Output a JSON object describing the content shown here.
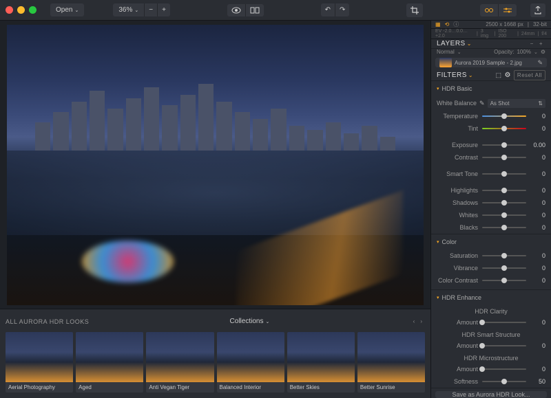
{
  "toolbar": {
    "open": "Open",
    "zoom": "36%"
  },
  "info": {
    "dims": "2500 x 1668 px",
    "depth": "32-bit",
    "ev": "EV -2.0…0.0…+2.0",
    "imgs": "3 img",
    "iso": "ISO 200",
    "focal": "24mm",
    "aperture": "f/4"
  },
  "layers": {
    "title": "LAYERS",
    "blend": "Normal",
    "opacity_label": "Opacity:",
    "opacity_val": "100%",
    "layer_name": "Aurora 2019 Sample - 2.jpg"
  },
  "filters": {
    "title": "FILTERS",
    "reset": "Reset All"
  },
  "hdr_basic": {
    "title": "HDR Basic",
    "wb_label": "White Balance",
    "wb_preset": "As Shot",
    "sliders": [
      {
        "label": "Temperature",
        "val": "0",
        "grad": "grad-temp"
      },
      {
        "label": "Tint",
        "val": "0",
        "grad": "grad-tint"
      },
      {
        "label": "Exposure",
        "val": "0.00"
      },
      {
        "label": "Contrast",
        "val": "0"
      },
      {
        "label": "Smart Tone",
        "val": "0"
      },
      {
        "label": "Highlights",
        "val": "0"
      },
      {
        "label": "Shadows",
        "val": "0"
      },
      {
        "label": "Whites",
        "val": "0"
      },
      {
        "label": "Blacks",
        "val": "0"
      }
    ]
  },
  "color": {
    "title": "Color",
    "sliders": [
      {
        "label": "Saturation",
        "val": "0"
      },
      {
        "label": "Vibrance",
        "val": "0"
      },
      {
        "label": "Color Contrast",
        "val": "0"
      }
    ]
  },
  "enhance": {
    "title": "HDR Enhance",
    "clarity": "HDR Clarity",
    "clarity_sliders": [
      {
        "label": "Amount",
        "val": "0",
        "pos": "0%"
      }
    ],
    "smart": "HDR Smart Structure",
    "smart_sliders": [
      {
        "label": "Amount",
        "val": "0",
        "pos": "0%"
      }
    ],
    "micro": "HDR Microstructure",
    "micro_sliders": [
      {
        "label": "Amount",
        "val": "0",
        "pos": "0%"
      },
      {
        "label": "Softness",
        "val": "50",
        "pos": "50%"
      }
    ]
  },
  "looks": {
    "title": "ALL AURORA HDR LOOKS",
    "collections": "Collections",
    "items": [
      "Aerial Photography",
      "Aged",
      "Anti Vegan Tiger",
      "Balanced Interior",
      "Better Skies",
      "Better Sunrise"
    ]
  },
  "save_look": "Save as Aurora HDR Look..."
}
